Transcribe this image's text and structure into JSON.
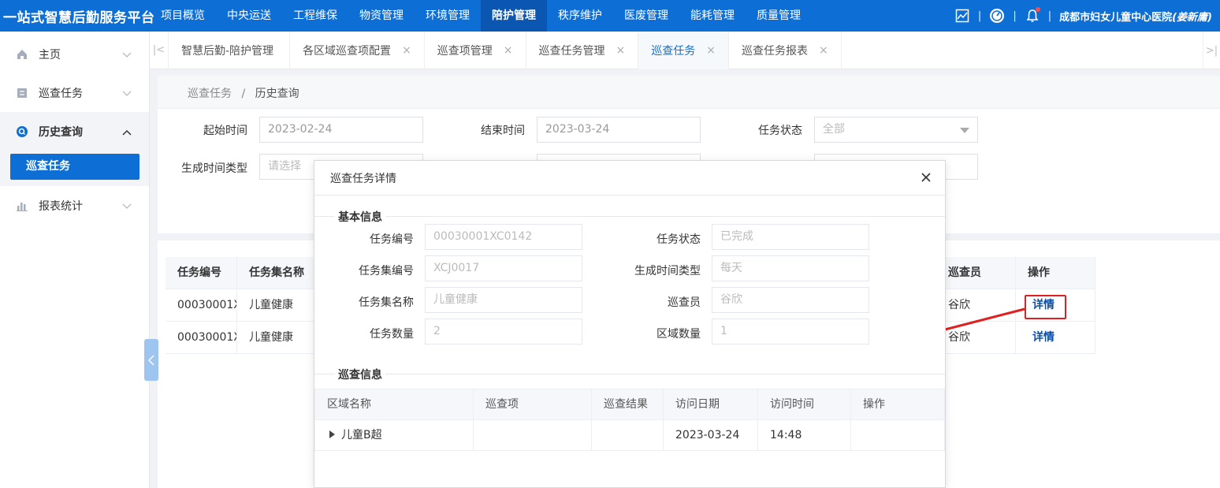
{
  "app": {
    "title": "一站式智慧后勤服务平台"
  },
  "nav": {
    "items": [
      "项目概览",
      "中央运送",
      "工程维保",
      "物资管理",
      "环境管理",
      "陪护管理",
      "秩序维护",
      "医废管理",
      "能耗管理",
      "质量管理"
    ],
    "active": "陪护管理"
  },
  "user": {
    "org": "成都市妇女儿童中心医院",
    "name": "(姜新庸)",
    "sep": "|"
  },
  "sidebar": {
    "home": "主页",
    "patrol_task": "巡查任务",
    "history": "历史查询",
    "history_sub": "巡查任务",
    "report": "报表统计"
  },
  "tabs": [
    "智慧后勤-陪护管理",
    "各区域巡查项配置",
    "巡查项管理",
    "巡查任务管理",
    "巡查任务",
    "巡查任务报表"
  ],
  "tab_active": "巡查任务",
  "tab_close": "×",
  "tab_prev": "|<",
  "tab_next": ">|",
  "breadcrumb": {
    "parent": "巡查任务",
    "sep": "/",
    "current": "历史查询"
  },
  "filters": {
    "start_label": "起始时间",
    "start_value": "2023-02-24",
    "end_label": "结束时间",
    "end_value": "2023-03-24",
    "status_label": "任务状态",
    "status_value": "全部",
    "gen_type_label": "生成时间类型",
    "gen_type_placeholder": "请选择"
  },
  "table": {
    "headers": {
      "task_no": "任务编号",
      "set_name": "任务集名称",
      "inspector": "巡查员",
      "op": "操作"
    },
    "rows": [
      {
        "task_no": "00030001XC",
        "set_name": "儿童健康",
        "inspector": "谷欣",
        "op": "详情"
      },
      {
        "task_no": "00030001XC",
        "set_name": "儿童健康",
        "inspector": "谷欣",
        "op": "详情"
      }
    ]
  },
  "modal": {
    "title": "巡查任务详情",
    "basic_title": "基本信息",
    "fields": {
      "task_no_label": "任务编号",
      "task_no": "00030001XC0142",
      "status_label": "任务状态",
      "status": "已完成",
      "set_no_label": "任务集编号",
      "set_no": "XCJ0017",
      "gen_type_label": "生成时间类型",
      "gen_type": "每天",
      "set_name_label": "任务集名称",
      "set_name": "儿童健康",
      "inspector_label": "巡查员",
      "inspector": "谷欣",
      "task_count_label": "任务数量",
      "task_count": "2",
      "area_count_label": "区域数量",
      "area_count": "1"
    },
    "patrol_title": "巡查信息",
    "table": {
      "headers": [
        "区域名称",
        "巡查项",
        "巡查结果",
        "访问日期",
        "访问时间",
        "操作"
      ],
      "row": {
        "area": "儿童B超",
        "item": "",
        "result": "",
        "date": "2023-03-24",
        "time": "14:48",
        "op": ""
      }
    }
  },
  "colors": {
    "primary": "#0d6fd6",
    "highlight": "#e02020"
  }
}
